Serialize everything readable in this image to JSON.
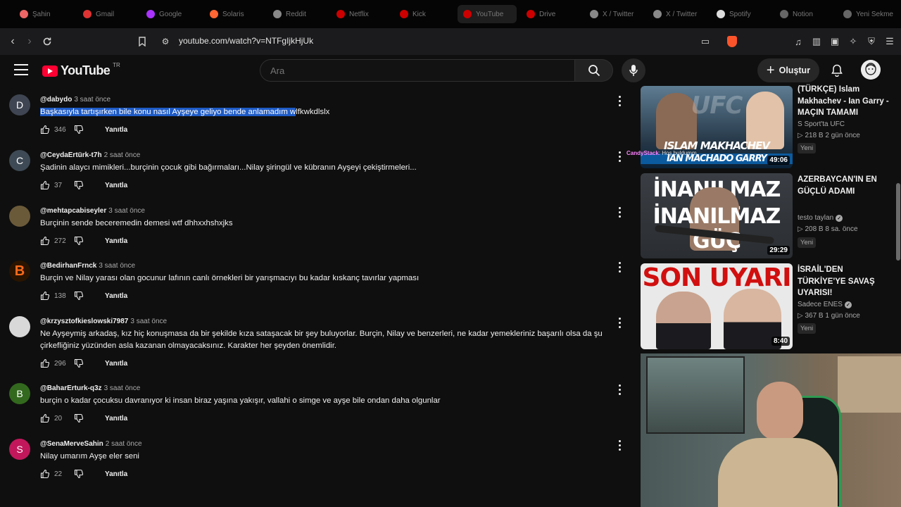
{
  "browser": {
    "tabs": [
      {
        "label": "Şahin",
        "color": "#e66"
      },
      {
        "label": "Gmail",
        "color": "#d33"
      },
      {
        "label": "Google",
        "color": "#a3f"
      },
      {
        "label": "Solaris",
        "color": "#f63"
      },
      {
        "label": "Reddit",
        "color": "#888"
      },
      {
        "label": "Netflix",
        "color": "#c00"
      },
      {
        "label": "Kick",
        "color": "#c00"
      },
      {
        "label": "YouTube",
        "color": "#c00"
      },
      {
        "label": "Drive",
        "color": "#c00"
      },
      {
        "label": "X / Twitter",
        "color": "#888"
      },
      {
        "label": "X / Twitter",
        "color": "#888"
      },
      {
        "label": "Spotify",
        "color": "#ddd"
      },
      {
        "label": "Notion",
        "color": "#666"
      },
      {
        "label": "Yeni Sekme",
        "color": "#666"
      }
    ],
    "url": "youtube.com/watch?v=NTFgIjkHjUk"
  },
  "header": {
    "logo_text": "YouTube",
    "region": "TR",
    "search_placeholder": "Ara",
    "create_label": "Oluştur"
  },
  "comments": [
    {
      "author": "@dabydo",
      "time": "3 saat önce",
      "text_selected": "Başkasıyla tartışırken bile konu nasıl Ayşeye geliyo bende anlamadım w",
      "text_rest": "lfkwkdlslx",
      "likes": "346",
      "reply": "Yanıtla",
      "avatar_letter": "D",
      "avatar_color": "#3f4552"
    },
    {
      "author": "@CeydaErtürk-t7h",
      "time": "2 saat önce",
      "text": "Şadinin alaycı mimikleri...burçinin çocuk gibi bağırmaları...Nilay  şiringül ve  kübranın Ayşeyi çekiştirmeleri...",
      "likes": "37",
      "reply": "Yanıtla",
      "avatar_letter": "C",
      "avatar_color": "#3e4a55"
    },
    {
      "author": "@mehtapcabiseyler",
      "time": "3 saat önce",
      "text": "Burçinin sende beceremedin demesi wtf dhhxxhshxjks",
      "likes": "272",
      "reply": "Yanıtla",
      "avatar_letter": "",
      "avatar_color": "#6b5a3a"
    },
    {
      "author": "@BedirhanFrnck",
      "time": "3 saat önce",
      "text": "Burçin ve Nilay yarası olan gocunur lafının canlı örnekleri bir yarışmacıyı bu kadar kıskanç tavırlar yapması",
      "likes": "138",
      "reply": "Yanıtla",
      "avatar_letter": "B",
      "avatar_color": "#2a1400"
    },
    {
      "author": "@krzysztofkieslowski7987",
      "time": "3 saat önce",
      "text": "Ne Ayşeymiş arkadaş, kız hiç konuşmasa da bir şekilde kıza sataşacak bir şey buluyorlar. Burçin, Nilay ve benzerleri, ne kadar yemekleriniz başarılı olsa da şu çirkefliğiniz yüzünden asla kazanan olmayacaksınız. Karakter her şeyden önemlidir.",
      "likes": "296",
      "reply": "Yanıtla",
      "avatar_letter": "",
      "avatar_color": "#d8d8d8"
    },
    {
      "author": "@BaharErturk-q3z",
      "time": "3 saat önce",
      "text": "burçin o kadar çocuksu davranıyor ki insan biraz yaşına yakışır, vallahi o simge ve ayşe bile ondan daha olgunlar",
      "likes": "20",
      "reply": "Yanıtla",
      "avatar_letter": "B",
      "avatar_color": "#33691e"
    },
    {
      "author": "@SenaMerveSahin",
      "time": "2 saat önce",
      "text": "Nilay umarım Ayşe eler seni",
      "likes": "22",
      "reply": "Yanıtla",
      "avatar_letter": "S",
      "avatar_color": "#c2185b"
    }
  ],
  "related": [
    {
      "title": "(TÜRKÇE) Islam Makhachev - Ian Garry - MAÇIN TAMAMI",
      "channel": "S Sport'ta UFC",
      "verified": false,
      "meta": "▷ 218 B  2 gün önce",
      "badge": "Yeni",
      "duration": "49:06",
      "thumb_top": "UFC",
      "thumb_bottom": "ISLAM MAKHACHEV",
      "thumb_bottom2": "IAN MACHADO GARRY"
    },
    {
      "title": "AZERBAYCAN'IN EN GÜÇLÜ ADAMI",
      "channel": "testo taylan",
      "verified": true,
      "meta": "▷ 208 B  8 sa. önce",
      "badge": "Yeni",
      "duration": "29:29",
      "thumb_top": "İNANILMAZ GÜÇ",
      "thumb_bottom": "İNANILMAZ GÜÇ"
    },
    {
      "title": "İSRAİL'DEN TÜRKİYE'YE SAVAŞ UYARISI!",
      "channel": "Sadece ENES",
      "verified": true,
      "meta": "▷ 367 B  1 gün önce",
      "badge": "Yeni",
      "duration": "8:40",
      "thumb_top": "SON UYARI"
    }
  ],
  "overlay": {
    "chat_user": "CandyStack",
    "chat_text": "Hoş buldumm"
  },
  "colors": {
    "bg": "#0f0f0f",
    "selection": "#1e5bc6",
    "yt_red": "#ff0033"
  }
}
